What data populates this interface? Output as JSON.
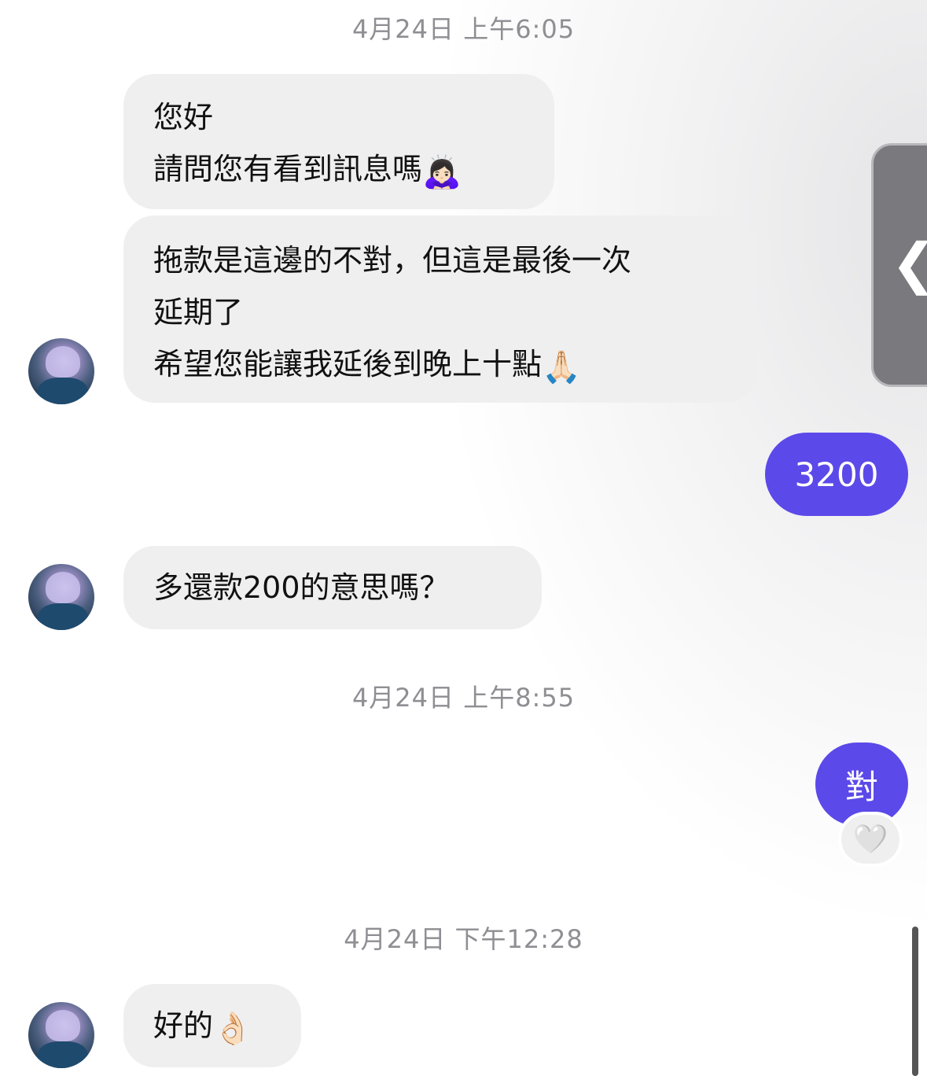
{
  "timestamps": [
    "4月24日 上午6:05",
    "4月24日 上午8:55",
    "4月24日 下午12:28"
  ],
  "messages": {
    "m1": [
      "您好",
      "請問您有看到訊息嗎"
    ],
    "m1_emoji": "🙇🏻‍♀️",
    "m2": [
      "拖款是這邊的不對，但這是最後一次",
      "延期了",
      "希望您能讓我延後到晚上十點"
    ],
    "m2_emoji": "🙏🏻",
    "out1": "3200",
    "m3": "多還款200的意思嗎？",
    "out2": "對",
    "out2_reaction": "🤍",
    "m4": "好的",
    "m4_emoji": "👌🏻"
  },
  "side_handle": {
    "icon": "chevron-left-icon",
    "glyph": "❮"
  },
  "colors": {
    "outgoing": "#5b49e9",
    "incoming": "#efefef",
    "timestamp": "#8e8e93"
  }
}
